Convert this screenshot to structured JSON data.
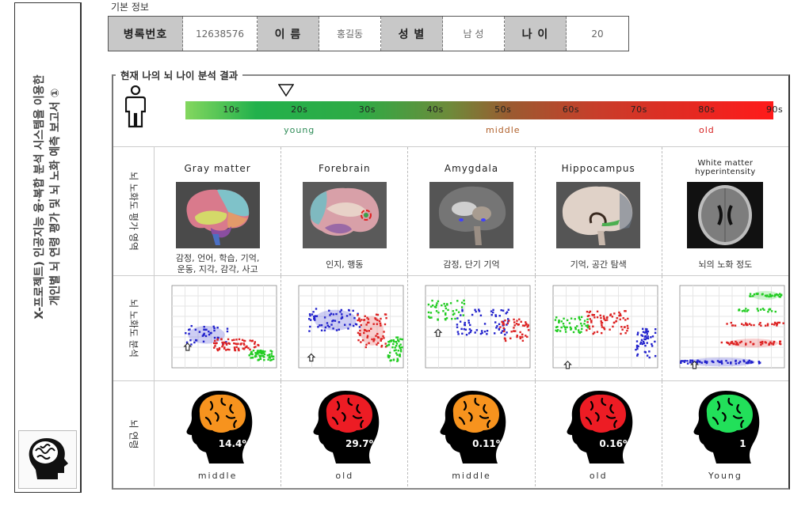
{
  "sidebar": {
    "title_line1": "X-프로젝트) 인공지능 융·복합 분석 시스템을 이용한",
    "title_line2": "개인별 뇌 연령 평가 및 뇌 노화 예측 보고서 ①",
    "logo_icon": "brain-head-icon"
  },
  "basic_info": {
    "section_label": "기본 정보",
    "fields": [
      {
        "label": "병록번호",
        "value": "12638576"
      },
      {
        "label": "이 름",
        "value": "홍길동"
      },
      {
        "label": "성 별",
        "value": "남 성"
      },
      {
        "label": "나 이",
        "value": "20"
      }
    ]
  },
  "result": {
    "title": "현재 나의 뇌 나이 분석 결과",
    "person_icon": "person-icon",
    "marker_icon": "triangle-down-marker-icon",
    "current_decade": "20s",
    "age_scale": {
      "ticks": [
        "10s",
        "20s",
        "30s",
        "40s",
        "50s",
        "60s",
        "70s",
        "80s",
        "90s"
      ],
      "colors": {
        "start": "#84d75f",
        "mid": "#9a5b30",
        "end": "#ff1a1a"
      },
      "categories": [
        {
          "label": "young",
          "color": "#2e8b57",
          "decade": "20s"
        },
        {
          "label": "middle",
          "color": "#b0602a",
          "decade": "50s"
        },
        {
          "label": "old",
          "color": "#d62020",
          "decade": "80s"
        }
      ]
    }
  },
  "rows": {
    "regions_label": "뇌 노화도 평가 영역",
    "analysis_label": "뇌 노화도 분석",
    "age_label": "뇌 연령"
  },
  "regions": [
    {
      "name": "Gray matter",
      "desc": "감정, 언어, 학습, 기억, 운동, 지각, 감각, 사고",
      "desc_line1": "감정, 언어, 학습, 기억,",
      "desc_line2": "운동, 지각, 감각, 사고",
      "result_pct": "14.4%",
      "result_cat": "middle",
      "brain_color": "#f7931e"
    },
    {
      "name": "Forebrain",
      "desc": "인지, 행동",
      "result_pct": "29.7%",
      "result_cat": "old",
      "brain_color": "#ed1c24"
    },
    {
      "name": "Amygdala",
      "desc": "감정, 단기 기억",
      "result_pct": "0.11%",
      "result_cat": "middle",
      "brain_color": "#f7931e"
    },
    {
      "name": "Hippocampus",
      "desc": "기억, 공간 탐색",
      "result_pct": "0.16%",
      "result_cat": "old",
      "brain_color": "#ed1c24"
    },
    {
      "name_line1": "White matter",
      "name_line2": "hyperintensity",
      "name": "White matter hyperintensity",
      "desc": "뇌의 노화 정도",
      "result_pct": "1",
      "result_cat": "Young",
      "brain_color": "#22e05a"
    }
  ],
  "series_colors": {
    "young": "#2222cc",
    "middle": "#dd2222",
    "old": "#22cc22",
    "marker": "#333333"
  }
}
